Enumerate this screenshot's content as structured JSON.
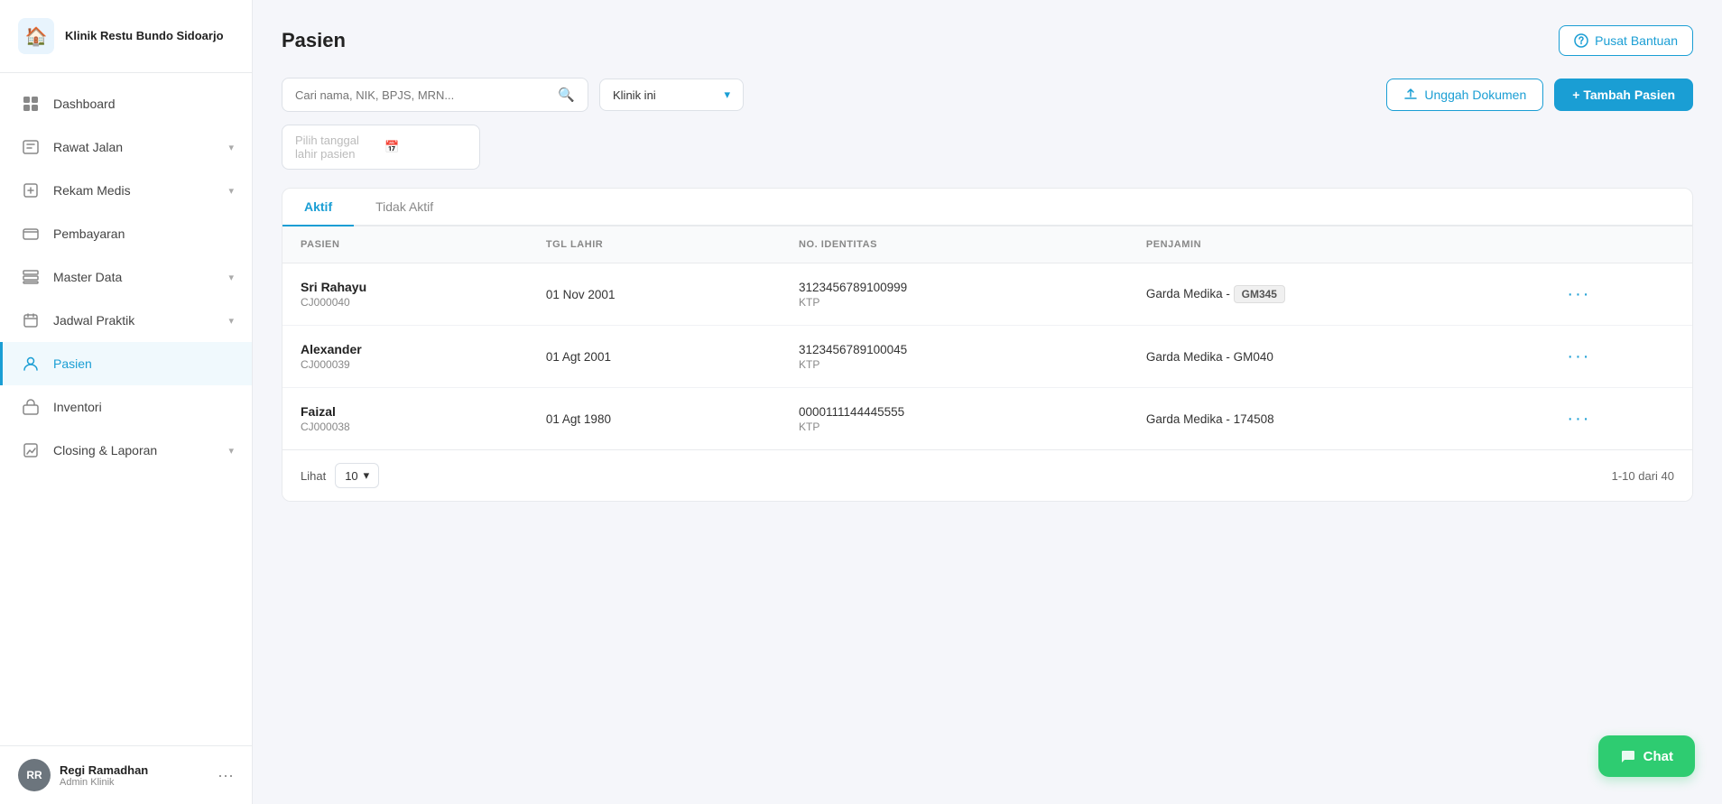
{
  "brand": {
    "name": "Klinik Restu Bundo Sidoarjo",
    "icon": "🏠"
  },
  "nav": {
    "items": [
      {
        "id": "dashboard",
        "label": "Dashboard",
        "icon": "⊞",
        "active": false,
        "hasChevron": false
      },
      {
        "id": "rawat-jalan",
        "label": "Rawat Jalan",
        "icon": "📋",
        "active": false,
        "hasChevron": true
      },
      {
        "id": "rekam-medis",
        "label": "Rekam Medis",
        "icon": "➕",
        "active": false,
        "hasChevron": true
      },
      {
        "id": "pembayaran",
        "label": "Pembayaran",
        "icon": "💳",
        "active": false,
        "hasChevron": false
      },
      {
        "id": "master-data",
        "label": "Master Data",
        "icon": "🗄",
        "active": false,
        "hasChevron": true
      },
      {
        "id": "jadwal-praktik",
        "label": "Jadwal Praktik",
        "icon": "📅",
        "active": false,
        "hasChevron": true
      },
      {
        "id": "pasien",
        "label": "Pasien",
        "icon": "👤",
        "active": true,
        "hasChevron": false
      },
      {
        "id": "inventori",
        "label": "Inventori",
        "icon": "📦",
        "active": false,
        "hasChevron": false
      },
      {
        "id": "closing-laporan",
        "label": "Closing & Laporan",
        "icon": "📊",
        "active": false,
        "hasChevron": true
      }
    ]
  },
  "user": {
    "name": "Regi Ramadhan",
    "role": "Admin Klinik",
    "avatar_initials": "RR"
  },
  "page": {
    "title": "Pasien",
    "help_button": "Pusat Bantuan"
  },
  "filters": {
    "search_placeholder": "Cari nama, NIK, BPJS, MRN...",
    "clinic_filter": "Klinik ini",
    "date_placeholder": "Pilih tanggal lahir pasien",
    "upload_label": "Unggah Dokumen",
    "add_label": "+ Tambah Pasien"
  },
  "tabs": [
    {
      "id": "aktif",
      "label": "Aktif",
      "active": true
    },
    {
      "id": "tidak-aktif",
      "label": "Tidak Aktif",
      "active": false
    }
  ],
  "table": {
    "columns": [
      "PASIEN",
      "TGL LAHIR",
      "NO. IDENTITAS",
      "PENJAMIN",
      ""
    ],
    "rows": [
      {
        "name": "Sri Rahayu",
        "id_code": "CJ000040",
        "tgl_lahir": "01 Nov 2001",
        "no_identitas": "3123456789100999",
        "id_type": "KTP",
        "penjamin": "Garda Medika - ",
        "penjamin_badge": "GM345"
      },
      {
        "name": "Alexander",
        "id_code": "CJ000039",
        "tgl_lahir": "01 Agt 2001",
        "no_identitas": "3123456789100045",
        "id_type": "KTP",
        "penjamin": "Garda Medika - GM040",
        "penjamin_badge": ""
      },
      {
        "name": "Faizal",
        "id_code": "CJ000038",
        "tgl_lahir": "01 Agt 1980",
        "no_identitas": "0000111144445555",
        "id_type": "KTP",
        "penjamin": "Garda Medika - 174508",
        "penjamin_badge": ""
      }
    ]
  },
  "footer": {
    "lihat_label": "Lihat",
    "count": "10",
    "pagination": "1-10 dari 40"
  },
  "chat": {
    "label": "Chat"
  }
}
